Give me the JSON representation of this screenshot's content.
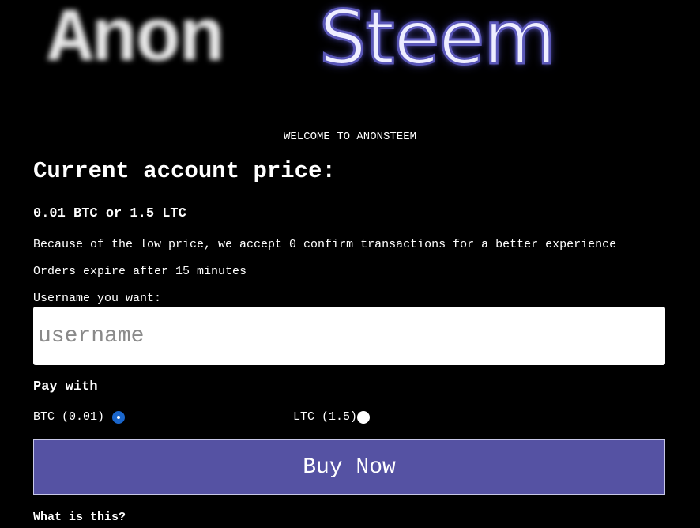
{
  "logo": {
    "part1": "Anon",
    "part2": "Steem",
    "part2_color": "#5a57b8"
  },
  "welcome": "WELCOME TO ANONSTEEM",
  "price": {
    "heading": "Current account price:",
    "value": "0.01 BTC or 1.5 LTC"
  },
  "notes": {
    "zero_confirm": "Because of the low price, we accept 0 confirm transactions for a better experience",
    "expiry": "Orders expire after 15 minutes"
  },
  "username": {
    "label": "Username you want:",
    "placeholder": "username",
    "value": ""
  },
  "payment": {
    "heading": "Pay with",
    "options": [
      {
        "label": "BTC (0.01)",
        "selected": true
      },
      {
        "label": "LTC (1.5)",
        "selected": false
      }
    ]
  },
  "buy_button": {
    "label": "Buy Now",
    "color": "#5552a3"
  },
  "faq": {
    "heading": "What is this?"
  }
}
